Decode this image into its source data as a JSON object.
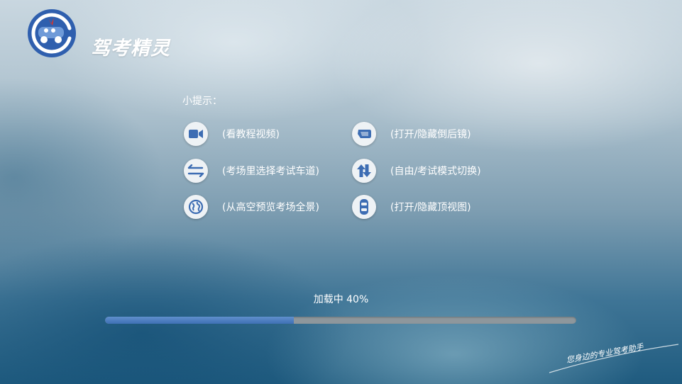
{
  "app": {
    "name": "驾考精灵",
    "logo_icon": "car-mascot-logo-icon",
    "accent_color": "#2f5fae"
  },
  "tips": {
    "title": "小提示：",
    "items": [
      {
        "icon": "video-camera-icon",
        "label": "(看教程视频)"
      },
      {
        "icon": "mirror-icon",
        "label": "(打开/隐藏倒后镜)"
      },
      {
        "icon": "swap-lanes-icon",
        "label": "(考场里选择考试车道)"
      },
      {
        "icon": "up-down-arrows-icon",
        "label": "(自由/考试模式切换)"
      },
      {
        "icon": "globe-icon",
        "label": "(从高空预览考场全景)"
      },
      {
        "icon": "car-top-view-icon",
        "label": "(打开/隐藏顶视图)"
      }
    ]
  },
  "loading": {
    "text": "加载中  40%",
    "progress": 0.4
  },
  "slogan": "您身边的专业驾考助手"
}
